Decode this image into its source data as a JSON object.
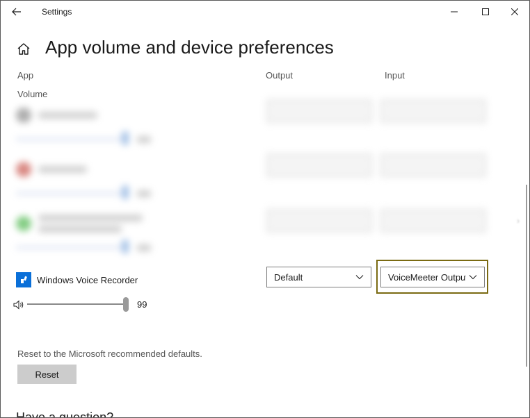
{
  "window": {
    "title": "Settings"
  },
  "header": {
    "title": "App volume and device preferences"
  },
  "columns": {
    "app": "App",
    "output": "Output",
    "input": "Input",
    "volume": "Volume"
  },
  "app_row": {
    "name": "Windows Voice Recorder",
    "volume": "99",
    "output_selected": "Default",
    "input_selected": "VoiceMeeter Output"
  },
  "reset": {
    "description": "Reset to the Microsoft recommended defaults.",
    "button_label": "Reset"
  },
  "help": {
    "heading": "Have a question?"
  },
  "colors": {
    "accent": "#0078d7",
    "focus_ring": "#7a6a12",
    "button_bg": "#cccccc"
  },
  "icons": [
    "back-arrow-icon",
    "minimize-icon",
    "maximize-icon",
    "close-icon",
    "home-icon",
    "voice-recorder-icon",
    "speaker-icon",
    "chevron-down-icon"
  ]
}
